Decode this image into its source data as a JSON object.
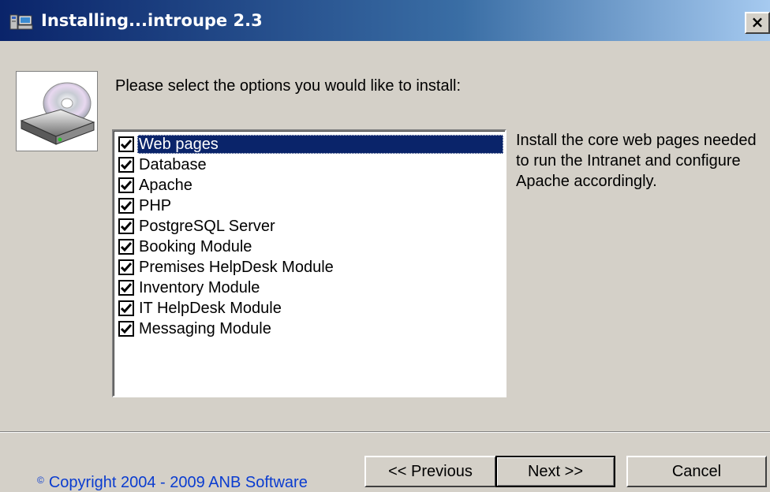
{
  "window": {
    "title": "Installing...introupe 2.3",
    "close_label": "×"
  },
  "wizard": {
    "prompt": "Please select the options you would like to install:",
    "options": [
      {
        "label": "Web pages",
        "checked": true,
        "selected": true
      },
      {
        "label": "Database",
        "checked": true,
        "selected": false
      },
      {
        "label": "Apache",
        "checked": true,
        "selected": false
      },
      {
        "label": "PHP",
        "checked": true,
        "selected": false
      },
      {
        "label": "PostgreSQL Server",
        "checked": true,
        "selected": false
      },
      {
        "label": "Booking Module",
        "checked": true,
        "selected": false
      },
      {
        "label": "Premises HelpDesk Module",
        "checked": true,
        "selected": false
      },
      {
        "label": "Inventory Module",
        "checked": true,
        "selected": false
      },
      {
        "label": "IT HelpDesk Module",
        "checked": true,
        "selected": false
      },
      {
        "label": "Messaging Module",
        "checked": true,
        "selected": false
      }
    ],
    "description": "Install the core web pages needed to run the Intranet and configure Apache accordingly."
  },
  "footer": {
    "copyright_symbol": "©",
    "copyright": "Copyright 2004 - 2009 ANB Software",
    "previous_label": "<< Previous",
    "next_label": "Next >>",
    "cancel_label": "Cancel"
  },
  "icons": {
    "title": "installer-app-icon",
    "close": "close-icon",
    "disk": "cd-drive-icon",
    "check": "checkmark-icon"
  },
  "colors": {
    "title_bar_start": "#0a246a",
    "title_bar_end": "#a6caf0",
    "selection": "#0a246a",
    "copyright_text": "#0a3cd0",
    "face": "#d4d0c8"
  }
}
